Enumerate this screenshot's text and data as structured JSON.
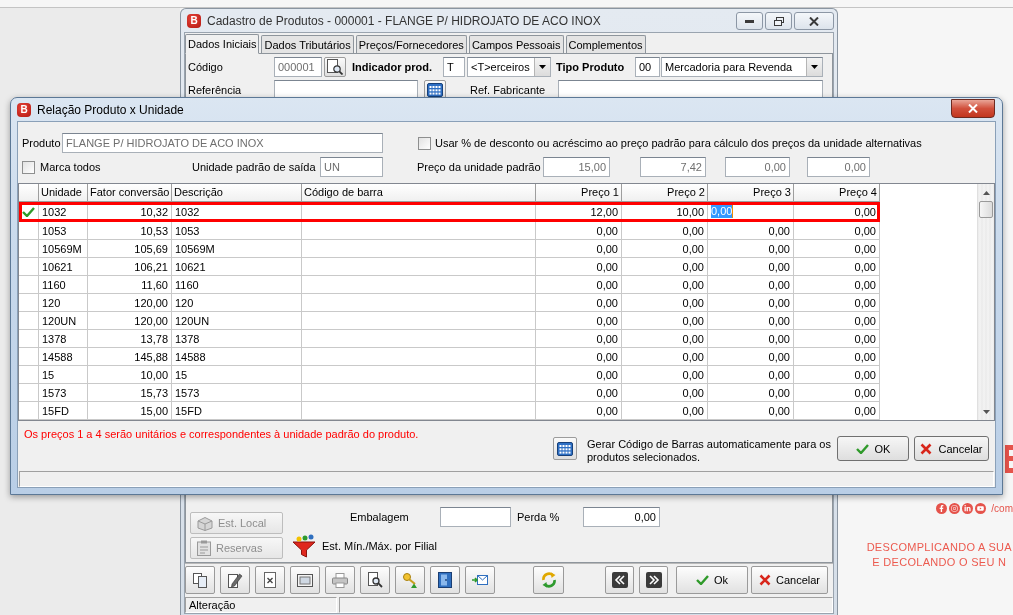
{
  "main_window": {
    "icon_letter": "B",
    "title": "Cadastro de Produtos - 000001 - FLANGE P/ HIDROJATO DE ACO INOX",
    "tabs": [
      {
        "label": "Dados Iniciais",
        "selected": true
      },
      {
        "label": "Dados Tributários",
        "selected": false
      },
      {
        "label": "Preços/Fornecedores",
        "selected": false
      },
      {
        "label": "Campos Pessoais",
        "selected": false
      },
      {
        "label": "Complementos",
        "selected": false
      }
    ],
    "codigo": {
      "label": "Código",
      "value": "000001",
      "disabled": true
    },
    "indicador": {
      "label": "Indicador prod.",
      "code": "T",
      "option": "<T>erceiros"
    },
    "tipo_produto": {
      "label": "Tipo Produto",
      "code": "00",
      "option": "Mercadoria para Revenda"
    },
    "referencia": {
      "label": "Referência"
    },
    "ref_fabricante": {
      "label": "Ref. Fabricante"
    },
    "side_buttons": [
      {
        "kind": "stock",
        "label": "Est. Local",
        "disabled": true
      },
      {
        "kind": "reserve",
        "label": "Reservas",
        "disabled": true
      }
    ],
    "embalagem": {
      "label": "Embalagem"
    },
    "perda": {
      "label": "Perda %",
      "value": "0,00"
    },
    "filial_button": {
      "label": "Est. Mín./Máx. por Filial"
    },
    "toolbar_actions": [
      {
        "kind": "ok",
        "label": "Ok"
      },
      {
        "kind": "cancel",
        "label": "Cancelar"
      }
    ],
    "status_bar": {
      "mode": "Alteração"
    }
  },
  "dialog": {
    "icon_letter": "B",
    "title": "Relação Produto x Unidade",
    "produto": {
      "label": "Produto",
      "value": "FLANGE P/ HIDROJATO DE ACO INOX",
      "disabled": true
    },
    "use_percent": {
      "label": "Usar % de desconto ou acréscimo ao preço padrão para cálculo dos preços da unidade alternativas",
      "checked": false
    },
    "mark_all": {
      "label": "Marca todos",
      "checked": false
    },
    "unidade_padrao": {
      "label": "Unidade padrão de saída",
      "value": "UN",
      "disabled": true
    },
    "preco_padrao": {
      "label": "Preço da unidade padrão",
      "values": [
        "15,00",
        "7,42",
        "0,00",
        "0,00"
      ],
      "disabled": true
    },
    "table": {
      "columns": [
        {
          "label": "Unidade",
          "kind": "text"
        },
        {
          "label": "Fator conversão",
          "kind": "number"
        },
        {
          "label": "Descrição",
          "kind": "text"
        },
        {
          "label": "Código de barra",
          "kind": "text"
        },
        {
          "label": "Preço 1",
          "kind": "price"
        },
        {
          "label": "Preço 2",
          "kind": "price"
        },
        {
          "label": "Preço 3",
          "kind": "price"
        },
        {
          "label": "Preço 4",
          "kind": "price"
        }
      ],
      "rows": [
        {
          "checked": true,
          "selected": true,
          "unidade": "1032",
          "fator": "10,32",
          "descricao": "1032",
          "prices": [
            {
              "value": "12,00",
              "editing": false
            },
            {
              "value": "10,00",
              "editing": false
            },
            {
              "value": "0,00",
              "editing": true
            },
            {
              "value": "0,00",
              "editing": false
            }
          ]
        },
        {
          "checked": false,
          "selected": false,
          "unidade": "1053",
          "fator": "10,53",
          "descricao": "1053",
          "prices": [
            {
              "value": "0,00",
              "editing": false
            },
            {
              "value": "0,00",
              "editing": false
            },
            {
              "value": "0,00",
              "editing": false
            },
            {
              "value": "0,00",
              "editing": false
            }
          ]
        },
        {
          "checked": false,
          "selected": false,
          "unidade": "10569M",
          "fator": "105,69",
          "descricao": "10569M",
          "prices": [
            {
              "value": "0,00",
              "editing": false
            },
            {
              "value": "0,00",
              "editing": false
            },
            {
              "value": "0,00",
              "editing": false
            },
            {
              "value": "0,00",
              "editing": false
            }
          ]
        },
        {
          "checked": false,
          "selected": false,
          "unidade": "10621",
          "fator": "106,21",
          "descricao": "10621",
          "prices": [
            {
              "value": "0,00",
              "editing": false
            },
            {
              "value": "0,00",
              "editing": false
            },
            {
              "value": "0,00",
              "editing": false
            },
            {
              "value": "0,00",
              "editing": false
            }
          ]
        },
        {
          "checked": false,
          "selected": false,
          "unidade": "1160",
          "fator": "11,60",
          "descricao": "1160",
          "prices": [
            {
              "value": "0,00",
              "editing": false
            },
            {
              "value": "0,00",
              "editing": false
            },
            {
              "value": "0,00",
              "editing": false
            },
            {
              "value": "0,00",
              "editing": false
            }
          ]
        },
        {
          "checked": false,
          "selected": false,
          "unidade": "120",
          "fator": "120,00",
          "descricao": "120",
          "prices": [
            {
              "value": "0,00",
              "editing": false
            },
            {
              "value": "0,00",
              "editing": false
            },
            {
              "value": "0,00",
              "editing": false
            },
            {
              "value": "0,00",
              "editing": false
            }
          ]
        },
        {
          "checked": false,
          "selected": false,
          "unidade": "120UN",
          "fator": "120,00",
          "descricao": "120UN",
          "prices": [
            {
              "value": "0,00",
              "editing": false
            },
            {
              "value": "0,00",
              "editing": false
            },
            {
              "value": "0,00",
              "editing": false
            },
            {
              "value": "0,00",
              "editing": false
            }
          ]
        },
        {
          "checked": false,
          "selected": false,
          "unidade": "1378",
          "fator": "13,78",
          "descricao": "1378",
          "prices": [
            {
              "value": "0,00",
              "editing": false
            },
            {
              "value": "0,00",
              "editing": false
            },
            {
              "value": "0,00",
              "editing": false
            },
            {
              "value": "0,00",
              "editing": false
            }
          ]
        },
        {
          "checked": false,
          "selected": false,
          "unidade": "14588",
          "fator": "145,88",
          "descricao": "14588",
          "prices": [
            {
              "value": "0,00",
              "editing": false
            },
            {
              "value": "0,00",
              "editing": false
            },
            {
              "value": "0,00",
              "editing": false
            },
            {
              "value": "0,00",
              "editing": false
            }
          ]
        },
        {
          "checked": false,
          "selected": false,
          "unidade": "15",
          "fator": "10,00",
          "descricao": "15",
          "prices": [
            {
              "value": "0,00",
              "editing": false
            },
            {
              "value": "0,00",
              "editing": false
            },
            {
              "value": "0,00",
              "editing": false
            },
            {
              "value": "0,00",
              "editing": false
            }
          ]
        },
        {
          "checked": false,
          "selected": false,
          "unidade": "1573",
          "fator": "15,73",
          "descricao": "1573",
          "prices": [
            {
              "value": "0,00",
              "editing": false
            },
            {
              "value": "0,00",
              "editing": false
            },
            {
              "value": "0,00",
              "editing": false
            },
            {
              "value": "0,00",
              "editing": false
            }
          ]
        },
        {
          "checked": false,
          "selected": false,
          "unidade": "15FD",
          "fator": "15,00",
          "descricao": "15FD",
          "prices": [
            {
              "value": "0,00",
              "editing": false
            },
            {
              "value": "0,00",
              "editing": false
            },
            {
              "value": "0,00",
              "editing": false
            },
            {
              "value": "0,00",
              "editing": false
            }
          ]
        }
      ]
    },
    "note": "Os preços 1 a 4 serão unitários e correspondentes à unidade padrão do produto.",
    "generate_label": "Gerar Código de Barras automaticamente para os produtos selecionados.",
    "buttons": [
      {
        "kind": "ok",
        "label": "OK"
      },
      {
        "kind": "cancel",
        "label": "Cancelar"
      }
    ]
  },
  "branding": {
    "handle": "/com",
    "slogan": [
      "DESCOMPLICANDO A SUA",
      "E DECOLANDO O SEU N"
    ]
  }
}
